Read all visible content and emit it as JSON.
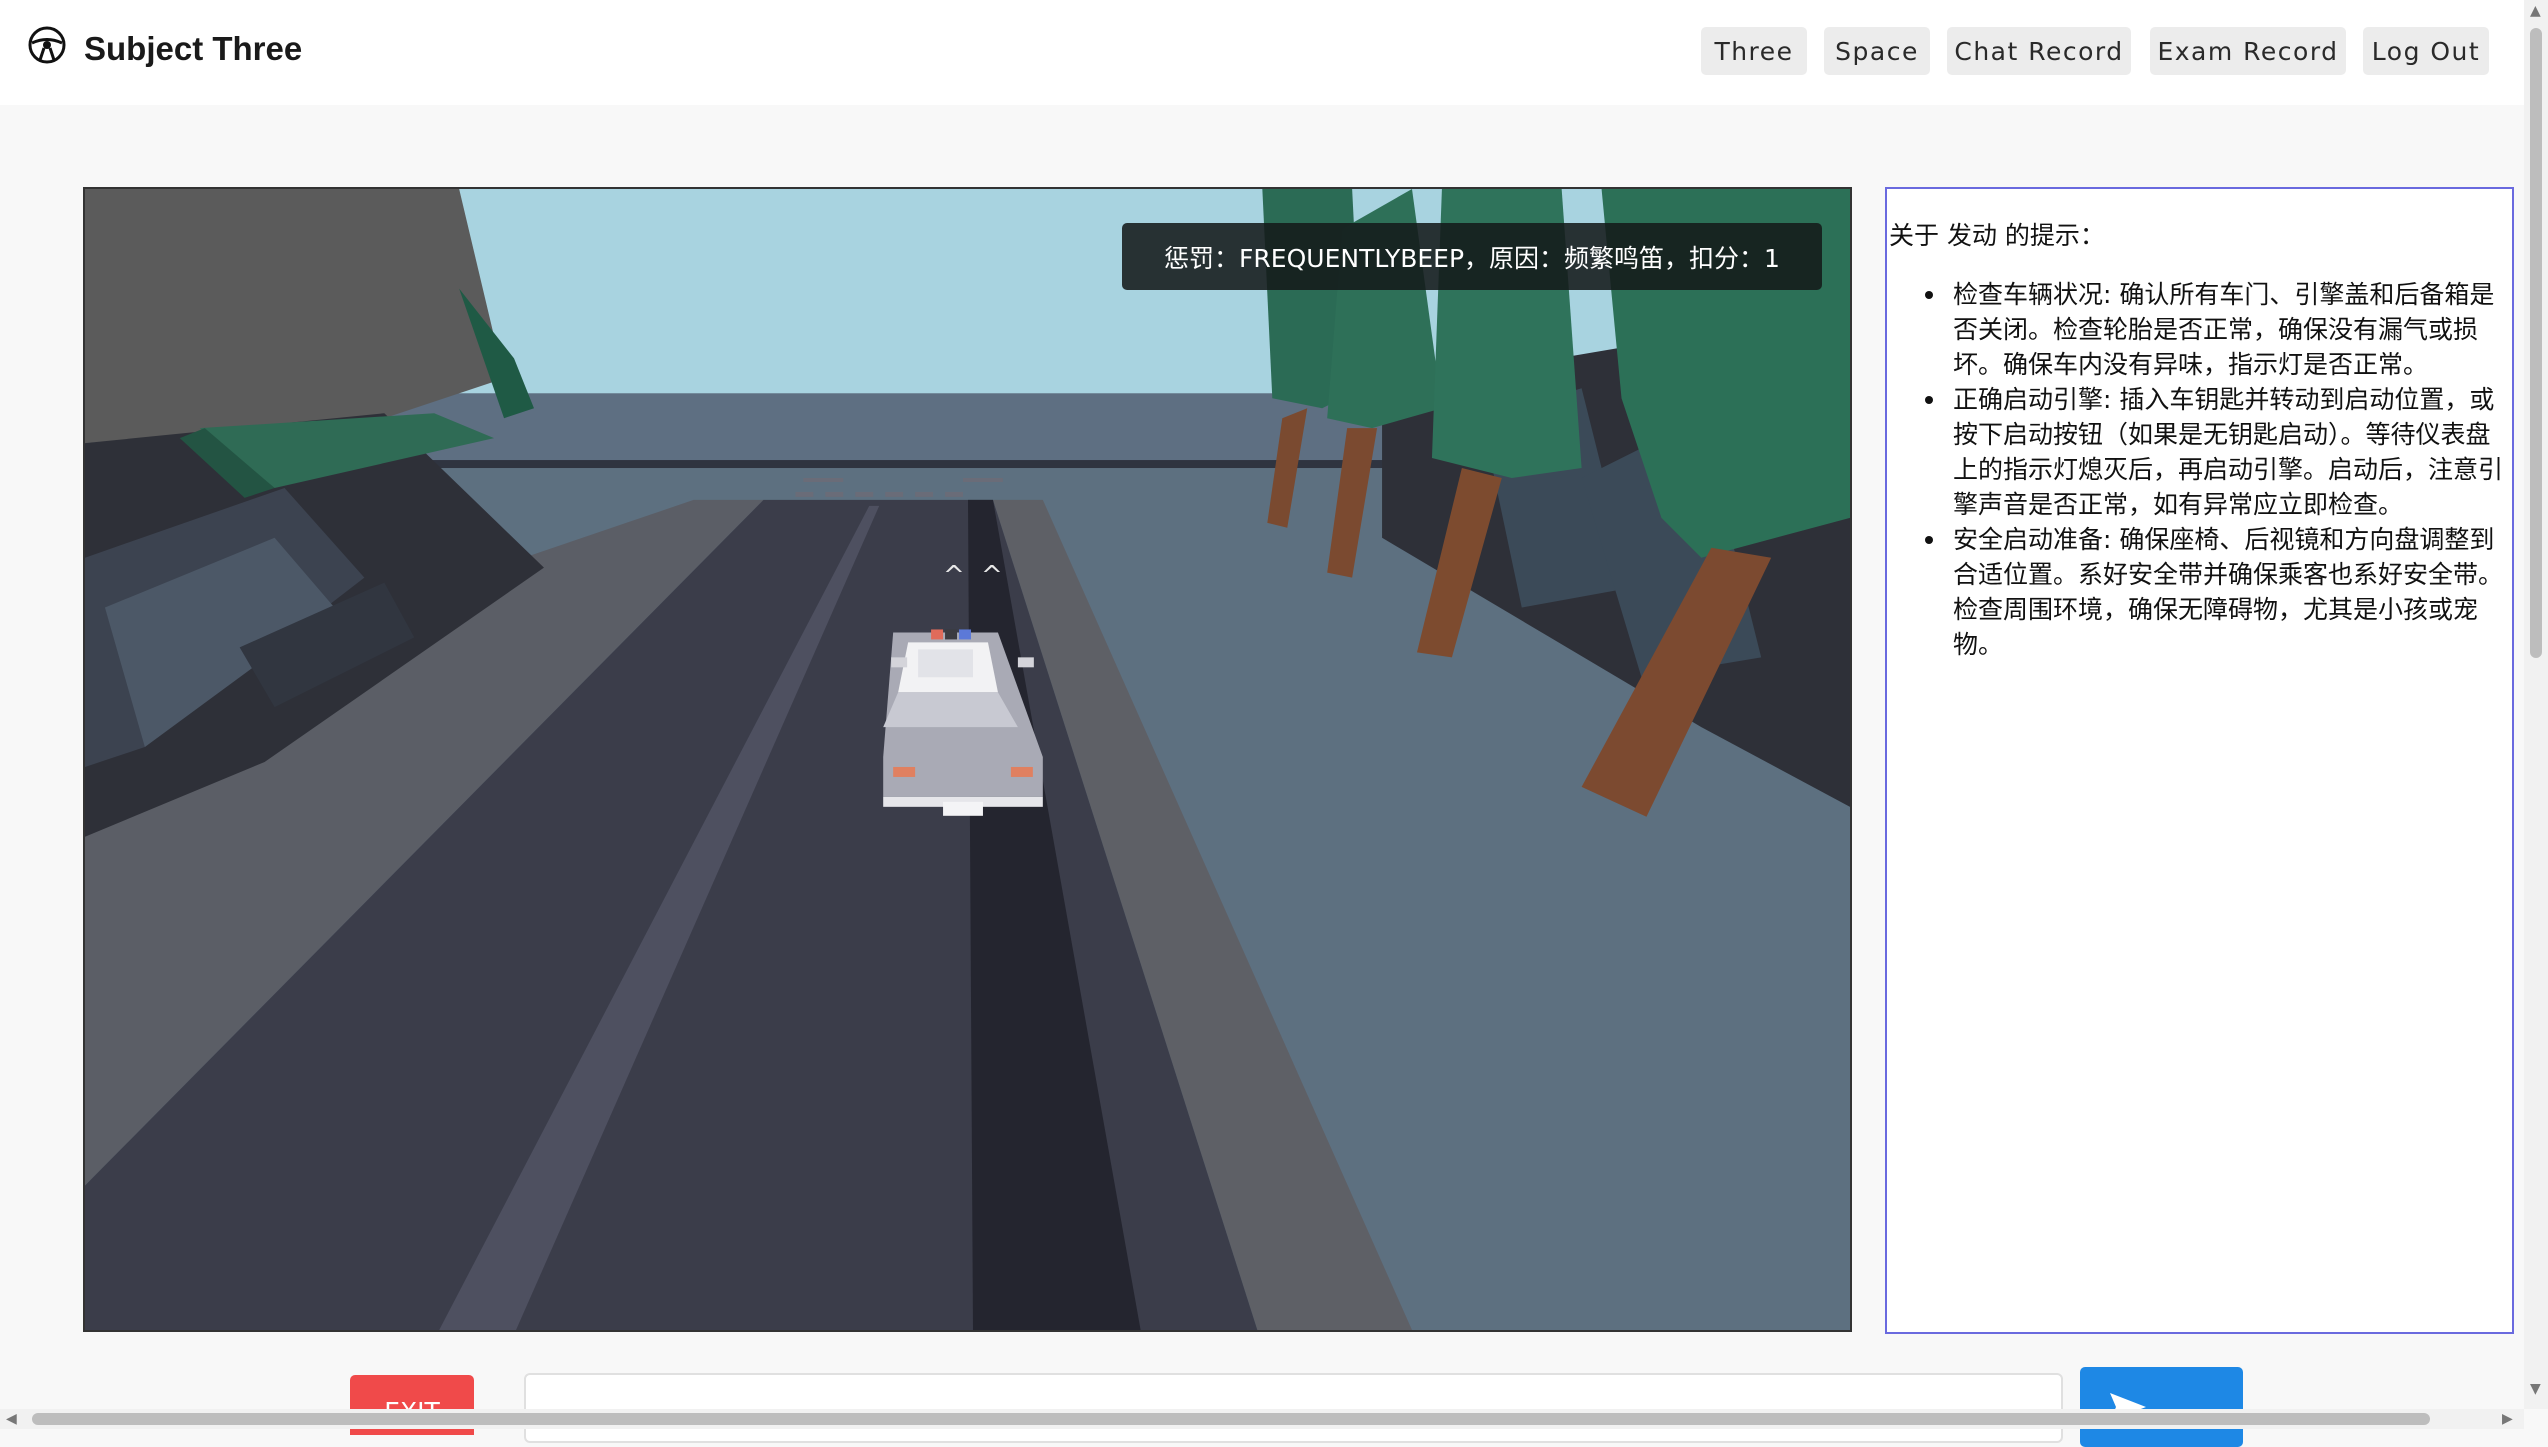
{
  "header": {
    "brand": "Subject Three",
    "nav": [
      {
        "label": "Three"
      },
      {
        "label": "Space"
      },
      {
        "label": "Chat Record"
      },
      {
        "label": "Exam Record"
      },
      {
        "label": "Log Out"
      }
    ]
  },
  "scene": {
    "penalty_text": "惩罚：FREQUENTLYBEEP，原因：频繁鸣笛，扣分：1",
    "beep_marks": "^ ^"
  },
  "tips": {
    "title": "关于 发动 的提示：",
    "items": [
      "检查车辆状况: 确认所有车门、引擎盖和后备箱是否关闭。检查轮胎是否正常，确保没有漏气或损坏。确保车内没有异味，指示灯是否正常。",
      "正确启动引擎: 插入车钥匙并转动到启动位置，或按下启动按钮（如果是无钥匙启动）。等待仪表盘上的指示灯熄灭后，再启动引擎。启动后，注意引擎声音是否正常，如有异常应立即检查。",
      "安全启动准备: 确保座椅、后视镜和方向盘调整到合适位置。系好安全带并确保乘客也系好安全带。检查周围环境，确保无障碍物，尤其是小孩或宠物。"
    ]
  },
  "controls": {
    "exit_label": "EXIT",
    "message_placeholder": ""
  },
  "icons": {
    "logo": "steering-wheel-icon",
    "send": "send-arrow-icon"
  },
  "colors": {
    "exit": "#f04a4a",
    "send": "#1e88e5",
    "tips_border": "#6a6adf"
  }
}
